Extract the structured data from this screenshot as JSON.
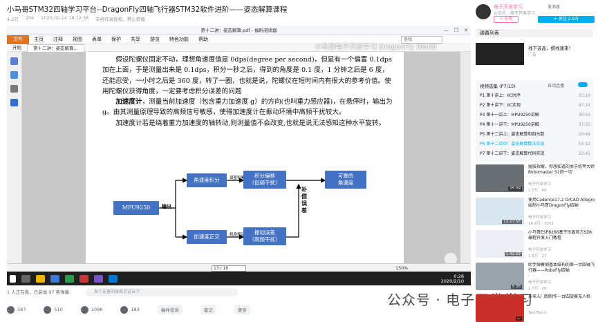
{
  "video": {
    "title": "小马哥STM32四轴学习平台--DragonFly四轴飞行器STM32软件进阶——姿态解算课程",
    "meta": [
      "4.2万",
      "204",
      "2020-02-14 18:12:38",
      "未经作者授权，禁止转载"
    ]
  },
  "pdf": {
    "window_title": "第十二讲：姿态解算.pdf - 福昕阅读器",
    "win_controls": [
      "—",
      "❐",
      "✕"
    ],
    "menu": [
      "文件",
      "主页",
      "注释",
      "视图",
      "表单",
      "保护",
      "共享",
      "游览",
      "特色功能",
      "帮助"
    ],
    "tabs": [
      "开始",
      "第十二讲：姿态解算..."
    ],
    "search_placeholder": "查找",
    "watermark": "小马哥电子开发学习 DragonFly World",
    "page_indicator": "13 / 16",
    "zoom": "150%",
    "paragraphs": [
      "假设陀螺仪固定不动，理想角速度值是 0dps(degree per second)，但是有一个偏置 0.1dps 加在上面，于是测量出来是 0.1dps，积分一秒之后，得到的角度是 0.1 度，1 分钟之后是 6 度，还能忍受，一小时之后是 360 度，转了一圈，也就是说，陀螺仪在短时间内有很大的参考价值。使用陀螺仪获得角度，一定要考虑积分误差的问题",
      "加速度计，测量当前加速度（包含重力加速度 g）的方向(也叫重力感应器)，在悬停时，输出为 g。由其测量原理导致的高频信号敏感，使得加速度计在振动环境中高频干扰较大。",
      "加速度计若是绕着重力加速度的轴转动,则测量值不会改变,也就是说无法感知这种水平旋转。"
    ],
    "bold_term": "加速度计",
    "diagram": {
      "source": "MPU9250",
      "output_label": "输出",
      "upper": "角速度积分",
      "upper_note": "误差积累",
      "drift": "积分偏移\n（低频干扰）",
      "lower": "加速度正交",
      "lower_note": "机身振动",
      "vibration": "振动误差\n（高频干扰）",
      "compensate": "补偿误差",
      "result": "可靠的\n角速度"
    },
    "taskbar_time": "0:28",
    "taskbar_date": "2020/2/10"
  },
  "player": {
    "viewers": "1 人正在看，已装填 97 条弹幕",
    "danmaku_placeholder": "发个友善的弹幕见证当下"
  },
  "actions": [
    {
      "icon": "like-icon",
      "count": "587"
    },
    {
      "icon": "coin-icon",
      "count": "510"
    },
    {
      "icon": "favorite-icon",
      "count": "2098"
    },
    {
      "icon": "share-icon",
      "count": "183"
    }
  ],
  "chips": [
    "稿件投诉",
    "笔记",
    "更多"
  ],
  "wechat_mark": "公众号 · 电子开发学习",
  "sidebar": {
    "up_name": "电子开发学习",
    "up_desc": "公众号：电子开发学习",
    "send_message": "发消息",
    "follow": "+ 充电",
    "subscribe": "+ 关注 2.9万",
    "danmu_list": "弹幕列表",
    "ad_title": "线下选品，撰线速来！",
    "ad_sub": "广告",
    "playlist_head": "视频选集 (P7/15)",
    "autoplay": "自动连播",
    "episodes": [
      {
        "t": "P1 第十讲上：IIC时序",
        "d": "33:19"
      },
      {
        "t": "P2 第十讲下：IIC实现",
        "d": "47:14"
      },
      {
        "t": "P3 第十一讲上：MPU9250讲解",
        "d": "39:55"
      },
      {
        "t": "P4 第十一讲下：MPU9250讲解",
        "d": "37:35"
      },
      {
        "t": "P5 第十二讲上：姿态解算和四元数",
        "d": "29:49"
      },
      {
        "t": "P6 第十二讲中：姿态解算算法实现",
        "d": "54:12"
      },
      {
        "t": "P7 第十二讲下：姿态解算代码实现",
        "d": "22:41"
      }
    ],
    "recs": [
      {
        "title": "猛肢拆解，你想知道的关于机甲大师Robomaster S1的一切",
        "up": "电子开发学习",
        "stat": "1.7万 · 66",
        "dur": "25:09"
      },
      {
        "title": "使用Cadence17.2 OrCAD Allegro绘制小马哥DragonFly四轴",
        "up": "电子开发学习",
        "stat": "34.9万 · 3251",
        "dur": "13:27:58"
      },
      {
        "title": "小马哥ESP8266基于乐鑫官方SDK编程开发入门教程",
        "up": "电子开发学习",
        "stat": "1.6万 · 27",
        "dur": "1:42:09"
      },
      {
        "title": "助手弹簧钢基本结构的第一台四轴飞行器——RoboFly四轴",
        "up": "电子开发学习",
        "stat": "1.7万 · 26",
        "dur": "5:38"
      },
      {
        "title": "从零入门到制作一台四旋翼无人机",
        "up": "TechTorch",
        "stat": "1.4万 · 8",
        "dur": "—"
      }
    ]
  }
}
